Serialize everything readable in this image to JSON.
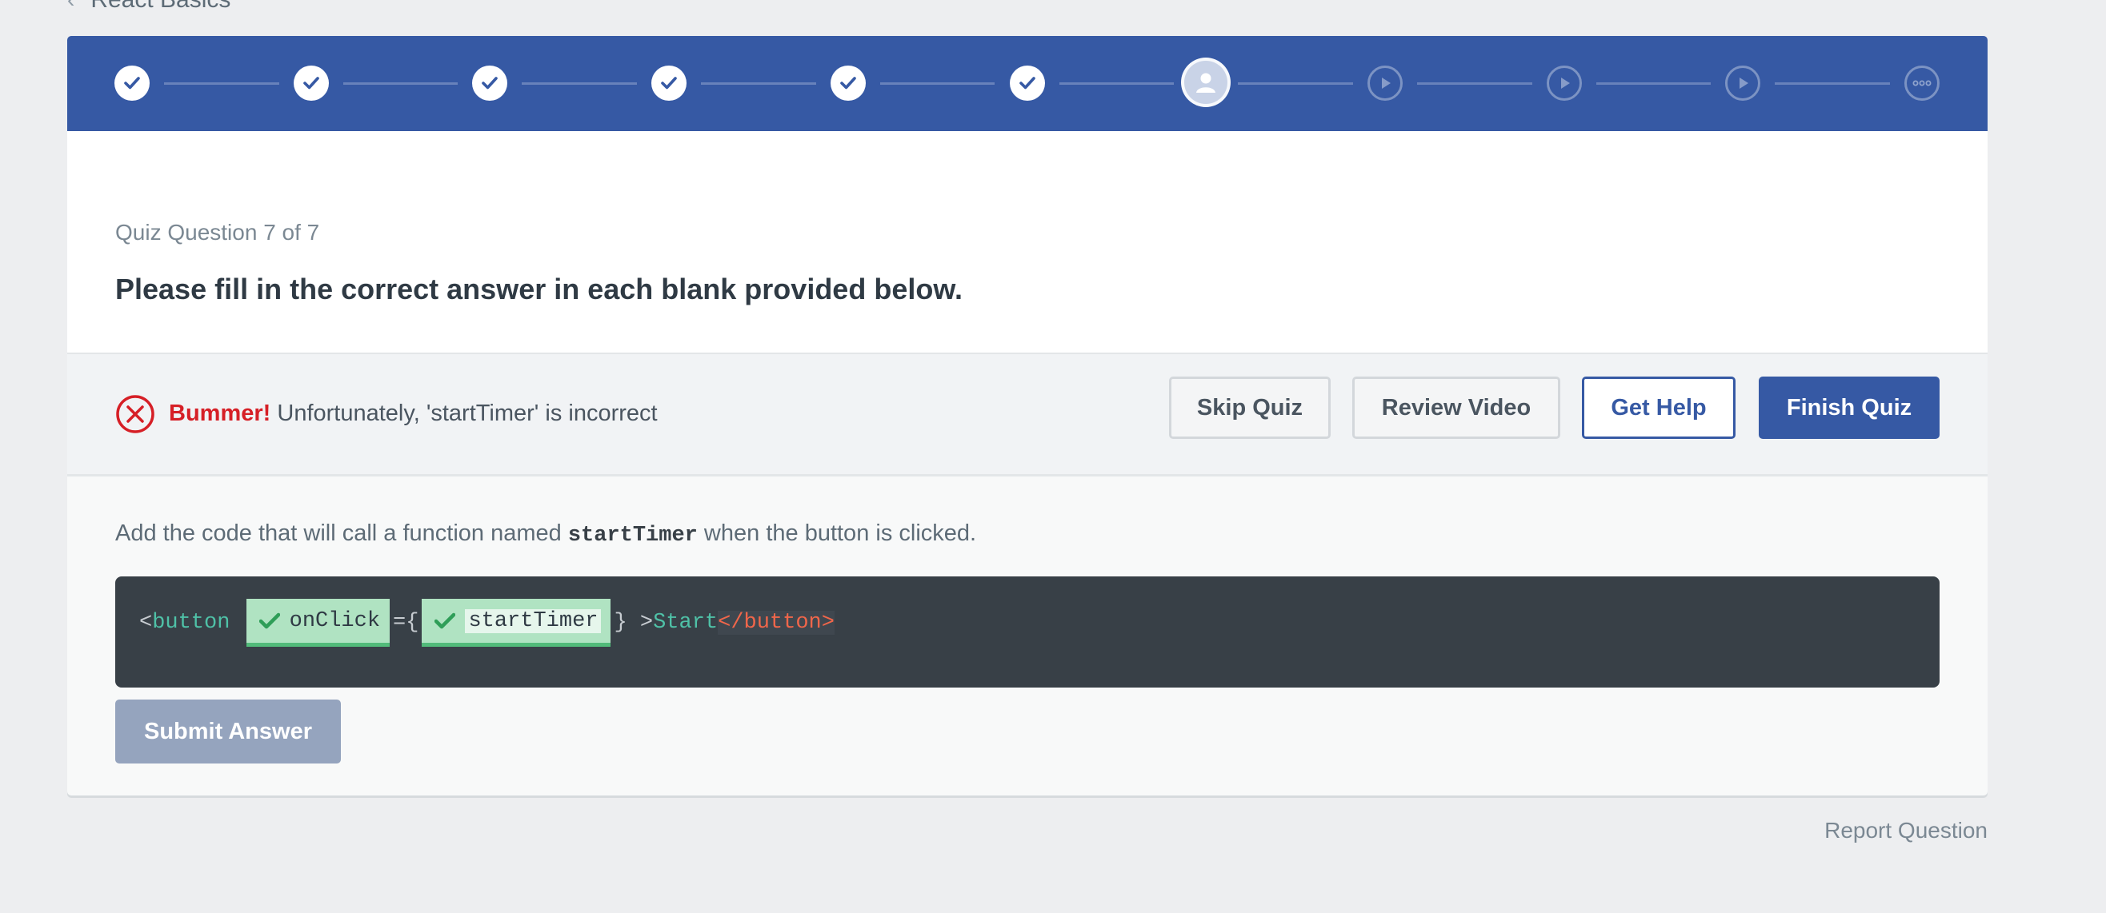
{
  "breadcrumb": {
    "title": "React Basics"
  },
  "progress": {
    "steps": [
      {
        "state": "done",
        "icon": "check-icon"
      },
      {
        "state": "done",
        "icon": "check-icon"
      },
      {
        "state": "done",
        "icon": "check-icon"
      },
      {
        "state": "done",
        "icon": "check-icon"
      },
      {
        "state": "done",
        "icon": "check-icon"
      },
      {
        "state": "done",
        "icon": "check-icon"
      },
      {
        "state": "current",
        "icon": "user-icon"
      },
      {
        "state": "upcoming",
        "icon": "play-icon"
      },
      {
        "state": "upcoming",
        "icon": "play-icon"
      },
      {
        "state": "upcoming",
        "icon": "play-icon"
      },
      {
        "state": "upcoming",
        "icon": "more-icon"
      }
    ]
  },
  "question": {
    "counter": "Quiz Question 7 of 7",
    "title": "Please fill in the correct answer in each blank provided below."
  },
  "feedback": {
    "label": "Bummer!",
    "message": "Unfortunately, 'startTimer' is incorrect",
    "status_color": "#d61f26"
  },
  "actions": {
    "skip": "Skip Quiz",
    "review": "Review Video",
    "help": "Get Help",
    "finish": "Finish Quiz"
  },
  "prompt": {
    "before": "Add the code that will call a function named ",
    "code": "startTimer",
    "after": " when the button is clicked."
  },
  "code": {
    "open_bracket": "<",
    "tag": "button",
    "blank1": "onClick",
    "equals_brace": "={",
    "blank2": "startTimer",
    "close_brace": "}",
    "gt": " >",
    "content": "Start",
    "lt": "<",
    "close_tag": "/button>"
  },
  "submit": {
    "label": "Submit Answer"
  },
  "footer": {
    "report": "Report Question"
  },
  "colors": {
    "brand": "#3659a4",
    "correct": "#52bb7a",
    "error": "#d61f26"
  }
}
